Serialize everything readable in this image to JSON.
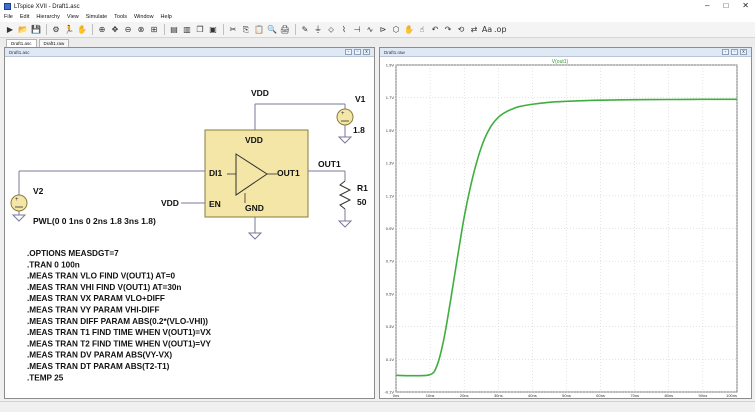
{
  "window": {
    "title": "LTspice XVII - Draft1.asc",
    "controls": [
      "–",
      "□",
      "✕"
    ]
  },
  "menu": [
    "File",
    "Edit",
    "Hierarchy",
    "View",
    "Simulate",
    "Tools",
    "Window",
    "Help"
  ],
  "toolbar_icons": [
    {
      "name": "run-icon",
      "glyph": "▶"
    },
    {
      "name": "open-icon",
      "glyph": "📂"
    },
    {
      "name": "save-icon",
      "glyph": "💾"
    },
    "sep",
    {
      "name": "control-panel-icon",
      "glyph": "⚙"
    },
    {
      "name": "run-sim-icon",
      "glyph": "🏃"
    },
    {
      "name": "halt-icon",
      "glyph": "✋"
    },
    "sep",
    {
      "name": "zoom-in-icon",
      "glyph": "⊕"
    },
    {
      "name": "pan-icon",
      "glyph": "✥"
    },
    {
      "name": "zoom-out-icon",
      "glyph": "⊖"
    },
    {
      "name": "zoom-full-icon",
      "glyph": "⊗"
    },
    {
      "name": "zoom-fit-icon",
      "glyph": "⊞"
    },
    "sep",
    {
      "name": "tile-horizontal-icon",
      "glyph": "▤"
    },
    {
      "name": "tile-vertical-icon",
      "glyph": "▥"
    },
    {
      "name": "cascade-icon",
      "glyph": "❐"
    },
    {
      "name": "close-window-icon",
      "glyph": "▣"
    },
    "sep",
    {
      "name": "cut-icon",
      "glyph": "✂"
    },
    {
      "name": "copy-icon",
      "glyph": "⎘"
    },
    {
      "name": "paste-icon",
      "glyph": "📋"
    },
    {
      "name": "find-icon",
      "glyph": "🔍"
    },
    {
      "name": "print-icon",
      "glyph": "🖨"
    },
    "sep",
    {
      "name": "wire-icon",
      "glyph": "✎"
    },
    {
      "name": "ground-icon",
      "glyph": "⏚"
    },
    {
      "name": "label-net-icon",
      "glyph": "⬦"
    },
    {
      "name": "resistor-icon",
      "glyph": "⌇"
    },
    {
      "name": "capacitor-icon",
      "glyph": "⊣"
    },
    {
      "name": "inductor-icon",
      "glyph": "∿"
    },
    {
      "name": "diode-icon",
      "glyph": "⊳"
    },
    {
      "name": "component-icon",
      "glyph": "⬡"
    },
    {
      "name": "move-icon",
      "glyph": "✋"
    },
    {
      "name": "drag-icon",
      "glyph": "☝"
    },
    {
      "name": "undo-icon",
      "glyph": "↶"
    },
    {
      "name": "redo-icon",
      "glyph": "↷"
    },
    {
      "name": "rotate-icon",
      "glyph": "⟲"
    },
    {
      "name": "mirror-icon",
      "glyph": "⇄"
    },
    {
      "name": "text-icon",
      "glyph": "Aa"
    },
    {
      "name": "spice-directive-icon",
      "glyph": ".op"
    }
  ],
  "tabs": [
    {
      "label": "Draft1.asc",
      "active": true
    },
    {
      "label": "Draft1.raw",
      "active": false
    }
  ],
  "schematic": {
    "pane_title": "Draft1.asc",
    "labels": {
      "vdd_top": "VDD",
      "vdd_inner": "VDD",
      "gnd_inner": "GND",
      "di1": "DI1",
      "en": "EN",
      "vdd_en": "VDD",
      "out1_pin": "OUT1",
      "out1_net": "OUT1",
      "v1_name": "V1",
      "v1_value": "1.8",
      "v2_name": "V2",
      "v2_value": "PWL(0 0 1ns 0 2ns 1.8 3ns 1.8)",
      "r1_name": "R1",
      "r1_value": "50"
    },
    "directives": [
      ".OPTIONS MEASDGT=7",
      ".TRAN 0 100n",
      ".MEAS TRAN VLO FIND V(OUT1) AT=0",
      ".MEAS TRAN VHI FIND V(OUT1) AT=30n",
      ".MEAS TRAN VX PARAM VLO+DIFF",
      ".MEAS TRAN VY PARAM VHI-DIFF",
      ".MEAS TRAN DIFF PARAM ABS(0.2*(VLO-VHI))",
      ".MEAS TRAN T1 FIND TIME WHEN V(OUT1)=VX",
      ".MEAS TRAN T2  FIND TIME WHEN V(OUT1)=VY",
      ".MEAS TRAN DV PARAM ABS(VY-VX)",
      ".MEAS TRAN DT PARAM ABS(T2-T1)",
      ".TEMP 25"
    ],
    "colors": {
      "amp_fill": "#f3e6a6",
      "amp_border": "#8a7b3c",
      "wire": "#7a7a9a"
    }
  },
  "chart_data": {
    "type": "line",
    "pane_title": "Draft1.raw",
    "series": [
      {
        "name": "V(out1)",
        "color": "#3fae3f",
        "x": [
          0,
          5,
          10,
          12,
          14,
          16,
          18,
          20,
          22,
          24,
          26,
          28,
          30,
          32,
          34,
          36,
          40,
          45,
          50,
          55,
          60,
          70,
          80,
          90,
          100
        ],
        "values": [
          0.002,
          0.0,
          0.006,
          0.06,
          0.22,
          0.46,
          0.72,
          0.97,
          1.17,
          1.33,
          1.45,
          1.53,
          1.58,
          1.61,
          1.63,
          1.645,
          1.66,
          1.672,
          1.678,
          1.682,
          1.685,
          1.688,
          1.689,
          1.69,
          1.69
        ]
      }
    ],
    "x_ticks": [
      "0ns",
      "10ns",
      "20ns",
      "30ns",
      "40ns",
      "50ns",
      "60ns",
      "70ns",
      "80ns",
      "90ns",
      "100ns"
    ],
    "y_ticks": [
      "1.9V",
      "1.7V",
      "1.5V",
      "1.3V",
      "1.1V",
      "0.9V",
      "0.7V",
      "0.5V",
      "0.3V",
      "0.1V",
      "-0.1V"
    ],
    "xlim": [
      0,
      100
    ],
    "ylim": [
      -0.1,
      1.9
    ],
    "xlabel": "",
    "ylabel": "",
    "grid": true
  }
}
